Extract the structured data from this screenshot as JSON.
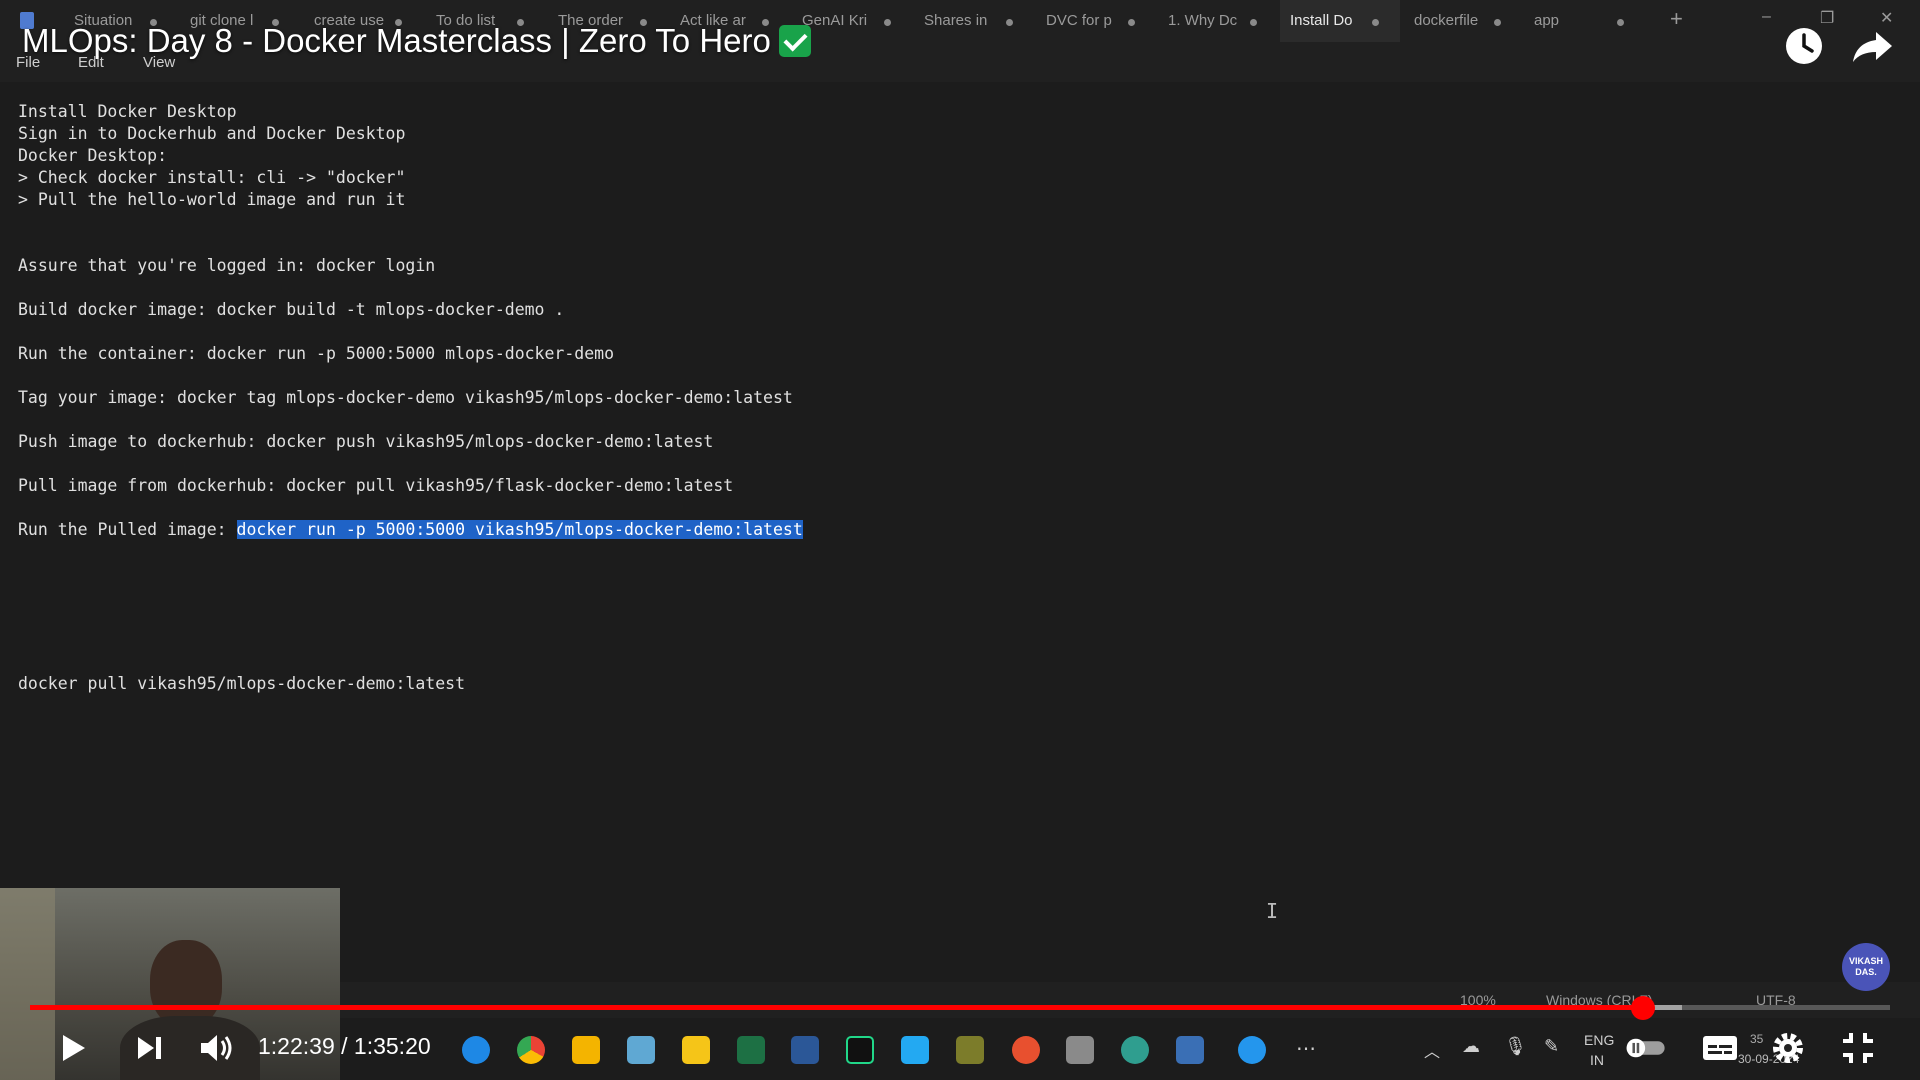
{
  "video": {
    "title": "MLOps: Day 8 - Docker Masterclass | Zero To Hero",
    "time_current": "1:22:39",
    "time_total": "1:35:20",
    "progress": 0.867,
    "channel_avatar": "VIKASH DAS."
  },
  "tabs": [
    "Situation",
    "git clone l",
    "create use",
    "To do list",
    "The order",
    "Act like ar",
    "GenAI Kri",
    "Shares in",
    "DVC for p",
    "1. Why Dc",
    "Install Do",
    "dockerfile",
    "app"
  ],
  "active_tab_index": 10,
  "menu": [
    "File",
    "Edit",
    "View"
  ],
  "editor": {
    "lines": [
      "Install Docker Desktop",
      "Sign in to Dockerhub and Docker Desktop",
      "Docker Desktop:",
      "> Check docker install: cli -> \"docker\"",
      "> Pull the hello-world image and run it",
      "Assure that you're logged in: docker login",
      "Build docker image: docker build -t mlops-docker-demo .",
      "Run the container: docker run -p 5000:5000 mlops-docker-demo",
      "Tag your image: docker tag mlops-docker-demo vikash95/mlops-docker-demo:latest",
      "Push image to dockerhub: docker push vikash95/mlops-docker-demo:latest",
      "Pull image from dockerhub: docker pull vikash95/flask-docker-demo:latest"
    ],
    "run_label": "Run the Pulled image: ",
    "run_selected": "docker run -p 5000:5000 vikash95/mlops-docker-demo:latest",
    "last_line": "docker pull vikash95/mlops-docker-demo:latest"
  },
  "statusbar": {
    "zoom": "100%",
    "line_ending": "Windows (CRLF)",
    "encoding": "UTF-8"
  },
  "tray": {
    "lang": "ENG",
    "region": "IN",
    "date": "30-09-2024",
    "time_fragment": "35"
  },
  "colors": {
    "progress": "#ff0000",
    "selection": "#1f63c7",
    "check": "#19a34a"
  }
}
